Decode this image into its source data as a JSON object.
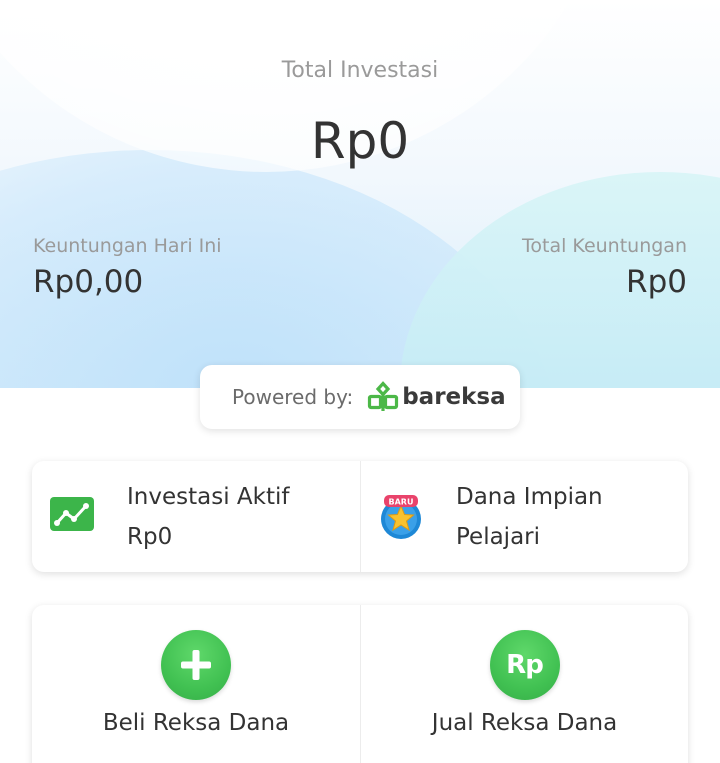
{
  "summary": {
    "total_label": "Total Investasi",
    "total_value": "Rp0",
    "profit_today_label": "Keuntungan Hari Ini",
    "profit_today_value": "Rp0,00",
    "profit_total_label": "Total Keuntungan",
    "profit_total_value": "Rp0"
  },
  "powered": {
    "label": "Powered by:",
    "brand": "bareksa",
    "brand_color": "#4cb848"
  },
  "shortcuts": [
    {
      "title": "Investasi Aktif",
      "subtitle": "Rp0",
      "icon": "chart-trend-icon"
    },
    {
      "title": "Dana Impian",
      "subtitle": "Pelajari",
      "icon": "star-badge-icon",
      "badge": "BARU"
    }
  ],
  "actions": [
    {
      "label": "Beli Reksa Dana",
      "icon": "plus-icon"
    },
    {
      "label": "Jual Reksa Dana",
      "icon": "rupiah-icon",
      "icon_text": "Rp"
    }
  ],
  "colors": {
    "accent_green": "#41c152",
    "text_primary": "#333333",
    "text_secondary": "#9a9a9a"
  }
}
